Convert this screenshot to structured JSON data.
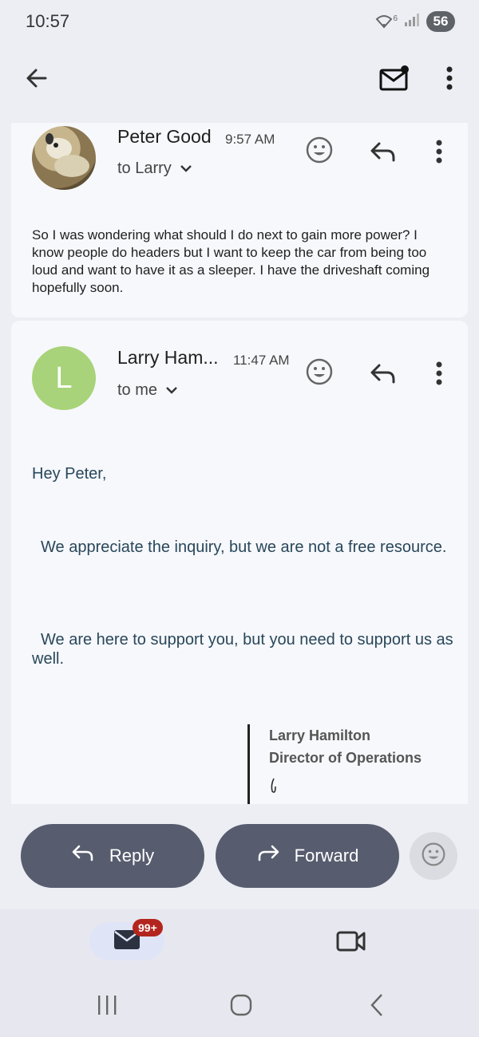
{
  "status_bar": {
    "time": "10:57",
    "battery": "56",
    "wifi_sup": "6"
  },
  "app_bar": {
    "back_icon": "arrow-back-icon",
    "mail_icon": "mail-unread-icon",
    "more_icon": "more-vert-icon"
  },
  "messages": [
    {
      "sender": "Peter Good",
      "time": "9:57 AM",
      "recipient": "to Larry",
      "body": "So I was wondering what should I do next to gain more power? I know people do headers but I want to keep the car from being too loud and want to have it as a sleeper. I have the driveshaft coming hopefully soon."
    },
    {
      "sender": "Larry Ham...",
      "avatar_letter": "L",
      "time": "11:47 AM",
      "recipient": "to me",
      "greeting": "Hey Peter,",
      "para1": "We appreciate the inquiry, but we are not a free resource.",
      "para2": "We are here to support you, but you need to support us as well.",
      "sig_name": "Larry Hamilton",
      "sig_title": "Director of Operations"
    }
  ],
  "actions": {
    "reply": "Reply",
    "forward": "Forward"
  },
  "bottom_nav": {
    "badge": "99+"
  },
  "colors": {
    "accent_button": "#575c6e",
    "avatar_green": "#a8d37a",
    "body_blue": "#28475a",
    "badge_red": "#b3261e"
  }
}
